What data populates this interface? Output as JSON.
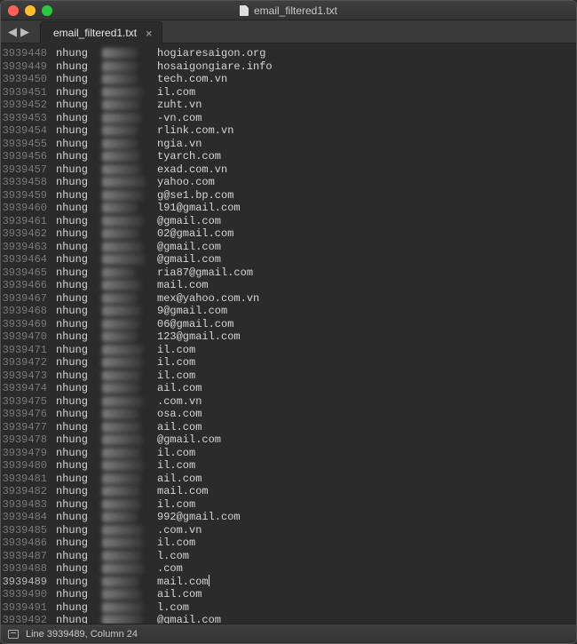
{
  "window": {
    "title": "email_filtered1.txt"
  },
  "tab": {
    "label": "email_filtered1.txt",
    "close": "×"
  },
  "nav": {
    "back": "◀",
    "forward": "▶"
  },
  "status": {
    "text": "Line 3939489, Column 24"
  },
  "rows": [
    {
      "ln": "3939448",
      "c1": "nhung",
      "bw": 40,
      "c3": "hogiaresaigon.org",
      "cur": false
    },
    {
      "ln": "3939449",
      "c1": "nhung",
      "bw": 40,
      "c3": "hosaigongiare.info",
      "cur": false
    },
    {
      "ln": "3939450",
      "c1": "nhung",
      "bw": 40,
      "c3": "tech.com.vn",
      "cur": false
    },
    {
      "ln": "3939451",
      "c1": "nhung",
      "bw": 45,
      "c3": "il.com",
      "cur": false
    },
    {
      "ln": "3939452",
      "c1": "nhung",
      "bw": 42,
      "c3": "zuht.vn",
      "cur": false
    },
    {
      "ln": "3939453",
      "c1": "nhung",
      "bw": 44,
      "c3": "-vn.com",
      "cur": false
    },
    {
      "ln": "3939454",
      "c1": "nhung",
      "bw": 41,
      "c3": "rlink.com.vn",
      "cur": false
    },
    {
      "ln": "3939455",
      "c1": "nhung",
      "bw": 40,
      "c3": "ngia.vn",
      "cur": false
    },
    {
      "ln": "3939456",
      "c1": "nhung",
      "bw": 43,
      "c3": "tyarch.com",
      "cur": false
    },
    {
      "ln": "3939457",
      "c1": "nhung",
      "bw": 44,
      "c3": "exad.com.vn",
      "cur": false
    },
    {
      "ln": "3939458",
      "c1": "nhung",
      "bw": 49,
      "c3": "yahoo.com",
      "cur": false
    },
    {
      "ln": "3939459",
      "c1": "nhung",
      "bw": 46,
      "c3": "g@se1.bp.com",
      "cur": false
    },
    {
      "ln": "3939460",
      "c1": "nhung",
      "bw": 40,
      "c3": "l91@gmail.com",
      "cur": false
    },
    {
      "ln": "3939461",
      "c1": "nhung",
      "bw": 46,
      "c3": "@gmail.com",
      "cur": false
    },
    {
      "ln": "3939462",
      "c1": "nhung",
      "bw": 42,
      "c3": "02@gmail.com",
      "cur": false
    },
    {
      "ln": "3939463",
      "c1": "nhung",
      "bw": 46,
      "c3": "@gmail.com",
      "cur": false
    },
    {
      "ln": "3939464",
      "c1": "nhung",
      "bw": 48,
      "c3": "@gmail.com",
      "cur": false
    },
    {
      "ln": "3939465",
      "c1": "nhung",
      "bw": 38,
      "c3": "ria87@gmail.com",
      "cur": false
    },
    {
      "ln": "3939466",
      "c1": "nhung",
      "bw": 44,
      "c3": "mail.com",
      "cur": false
    },
    {
      "ln": "3939467",
      "c1": "nhung",
      "bw": 40,
      "c3": "mex@yahoo.com.vn",
      "cur": false
    },
    {
      "ln": "3939468",
      "c1": "nhung",
      "bw": 44,
      "c3": "9@gmail.com",
      "cur": false
    },
    {
      "ln": "3939469",
      "c1": "nhung",
      "bw": 42,
      "c3": "06@gmail.com",
      "cur": false
    },
    {
      "ln": "3939470",
      "c1": "nhung",
      "bw": 40,
      "c3": "123@gmail.com",
      "cur": false
    },
    {
      "ln": "3939471",
      "c1": "nhung",
      "bw": 46,
      "c3": "il.com",
      "cur": false
    },
    {
      "ln": "3939472",
      "c1": "nhung",
      "bw": 46,
      "c3": "il.com",
      "cur": false
    },
    {
      "ln": "3939473",
      "c1": "nhung",
      "bw": 44,
      "c3": "il.com",
      "cur": false
    },
    {
      "ln": "3939474",
      "c1": "nhung",
      "bw": 42,
      "c3": "ail.com",
      "cur": false
    },
    {
      "ln": "3939475",
      "c1": "nhung",
      "bw": 46,
      "c3": ".com.vn",
      "cur": false
    },
    {
      "ln": "3939476",
      "c1": "nhung",
      "bw": 42,
      "c3": "osa.com",
      "cur": false
    },
    {
      "ln": "3939477",
      "c1": "nhung",
      "bw": 44,
      "c3": "ail.com",
      "cur": false
    },
    {
      "ln": "3939478",
      "c1": "nhung",
      "bw": 46,
      "c3": "@gmail.com",
      "cur": false
    },
    {
      "ln": "3939479",
      "c1": "nhung",
      "bw": 44,
      "c3": "il.com",
      "cur": false
    },
    {
      "ln": "3939480",
      "c1": "nhung",
      "bw": 46,
      "c3": "il.com",
      "cur": false
    },
    {
      "ln": "3939481",
      "c1": "nhung",
      "bw": 44,
      "c3": "ail.com",
      "cur": false
    },
    {
      "ln": "3939482",
      "c1": "nhung",
      "bw": 43,
      "c3": "mail.com",
      "cur": false
    },
    {
      "ln": "3939483",
      "c1": "nhung",
      "bw": 44,
      "c3": "il.com",
      "cur": false
    },
    {
      "ln": "3939484",
      "c1": "nhung",
      "bw": 40,
      "c3": "992@gmail.com",
      "cur": false
    },
    {
      "ln": "3939485",
      "c1": "nhung",
      "bw": 46,
      "c3": ".com.vn",
      "cur": false
    },
    {
      "ln": "3939486",
      "c1": "nhung",
      "bw": 46,
      "c3": "il.com",
      "cur": false
    },
    {
      "ln": "3939487",
      "c1": "nhung",
      "bw": 45,
      "c3": "l.com",
      "cur": false
    },
    {
      "ln": "3939488",
      "c1": "nhung",
      "bw": 47,
      "c3": ".com",
      "cur": false
    },
    {
      "ln": "3939489",
      "c1": "nhung",
      "bw": 42,
      "c3": "mail.com",
      "cur": true
    },
    {
      "ln": "3939490",
      "c1": "nhung",
      "bw": 44,
      "c3": "ail.com",
      "cur": false
    },
    {
      "ln": "3939491",
      "c1": "nhung",
      "bw": 46,
      "c3": "l.com",
      "cur": false
    },
    {
      "ln": "3939492",
      "c1": "nhung",
      "bw": 46,
      "c3": "@gmail.com",
      "cur": false
    }
  ]
}
